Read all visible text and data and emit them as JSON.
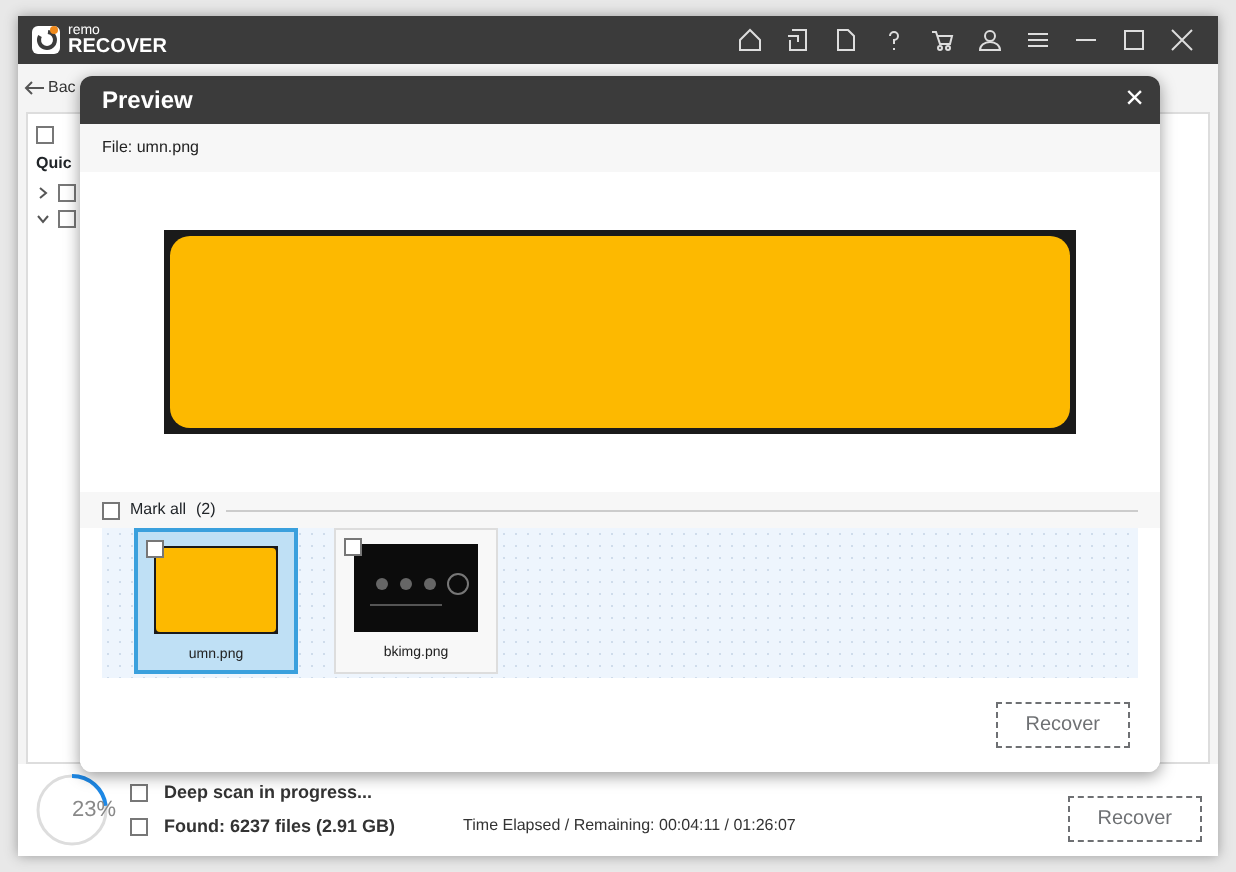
{
  "app": {
    "logo_top": "remo",
    "logo_bottom": "RECOVER",
    "toolbar_back": "Bac",
    "select_all_checked": false,
    "quick_label": "Quic",
    "tree": [
      {
        "expanded": false,
        "checked": false
      },
      {
        "expanded": true,
        "checked": false
      }
    ]
  },
  "status": {
    "percent": "23%",
    "level": 0.23,
    "line_1": "Deep scan in progress...",
    "found": "Found: 6237 files (2.91 GB)",
    "time": "Time Elapsed / Remaining: 00:04:11 / 01:26:07",
    "recover": "Recover",
    "recover_disabled": true
  },
  "preview": {
    "title": "Preview",
    "close": "×",
    "file": "File: umn.png",
    "mark_all": {
      "label": "Mark all",
      "count": "(2)",
      "checked": false
    },
    "thumbnails": [
      {
        "name": "umn.png",
        "kind": "yellow",
        "selected": true,
        "checked": false
      },
      {
        "name": "bkimg.png",
        "kind": "dark",
        "selected": false,
        "checked": false
      }
    ],
    "recover": "Recover",
    "recover_disabled": true
  }
}
